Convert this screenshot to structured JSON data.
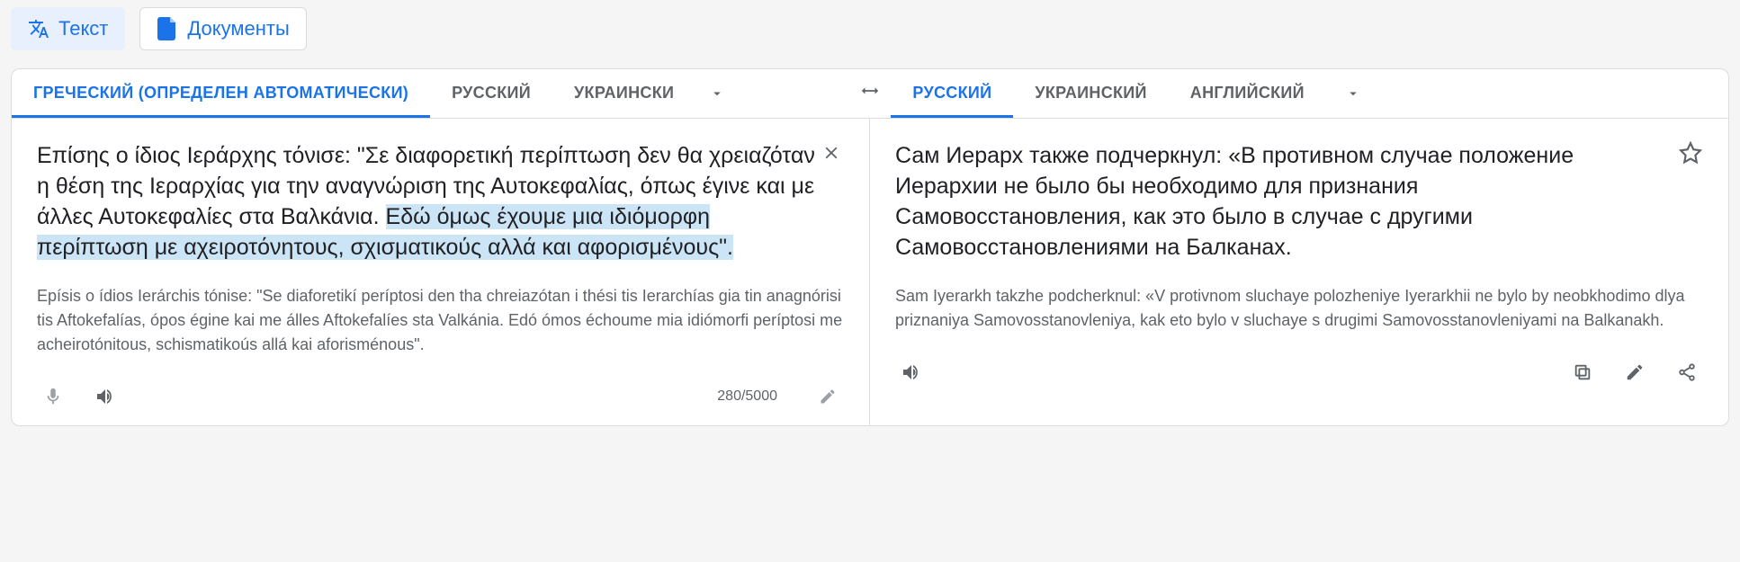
{
  "modes": {
    "text": "Текст",
    "documents": "Документы"
  },
  "source_tabs": {
    "detected": "ГРЕЧЕСКИЙ (ОПРЕДЕЛЕН АВТОМАТИЧЕСКИ)",
    "russian": "РУССКИЙ",
    "ukrainian": "УКРАИНСКИ"
  },
  "target_tabs": {
    "russian": "РУССКИЙ",
    "ukrainian": "УКРАИНСКИЙ",
    "english": "АНГЛИЙСКИЙ"
  },
  "source": {
    "text_before_highlight": "Επίσης ο ίδιος Ιεράρχης τόνισε: \"Σε διαφορετική περίπτωση δεν θα χρειαζόταν η θέση της Ιεραρχίας για την αναγνώριση της Αυτοκεφαλίας, όπως έγινε και με άλλες Αυτοκεφαλίες στα Βαλκάνια. ",
    "text_highlight": "Εδώ όμως έχουμε μια ιδιόμορφη περίπτωση με αχειροτόνητους, σχισματικούς αλλά και αφορισμένους\".",
    "translit": "Epísis o ídios Ierárchis tónise: \"Se diaforetikí períptosi den tha chreiazótan i thési tis Ierarchías gia tin anagnórisi tis Aftokefalías, ópos égine kai me álles Aftokefalíes sta Valkánia. Edó ómos échoume mia idiómorfi períptosi me acheirotónitous, schismatikoús allá kai aforisménous\".",
    "count": "280/5000"
  },
  "target": {
    "text": "Сам Иерарх также подчеркнул: «В противном случае положение Иерархии не было бы необходимо для признания Самовосстановления, как это было в случае с другими Самовосстановлениями на Балканах.",
    "translit": "Sam Iyerarkh takzhe podcherknul: «V protivnom sluchaye polozheniye Iyerarkhii ne bylo by neobkhodimo dlya priznaniya Samovosstanovleniya, kak eto bylo v sluchaye s drugimi Samovosstanovleniyami na Balkanakh."
  }
}
